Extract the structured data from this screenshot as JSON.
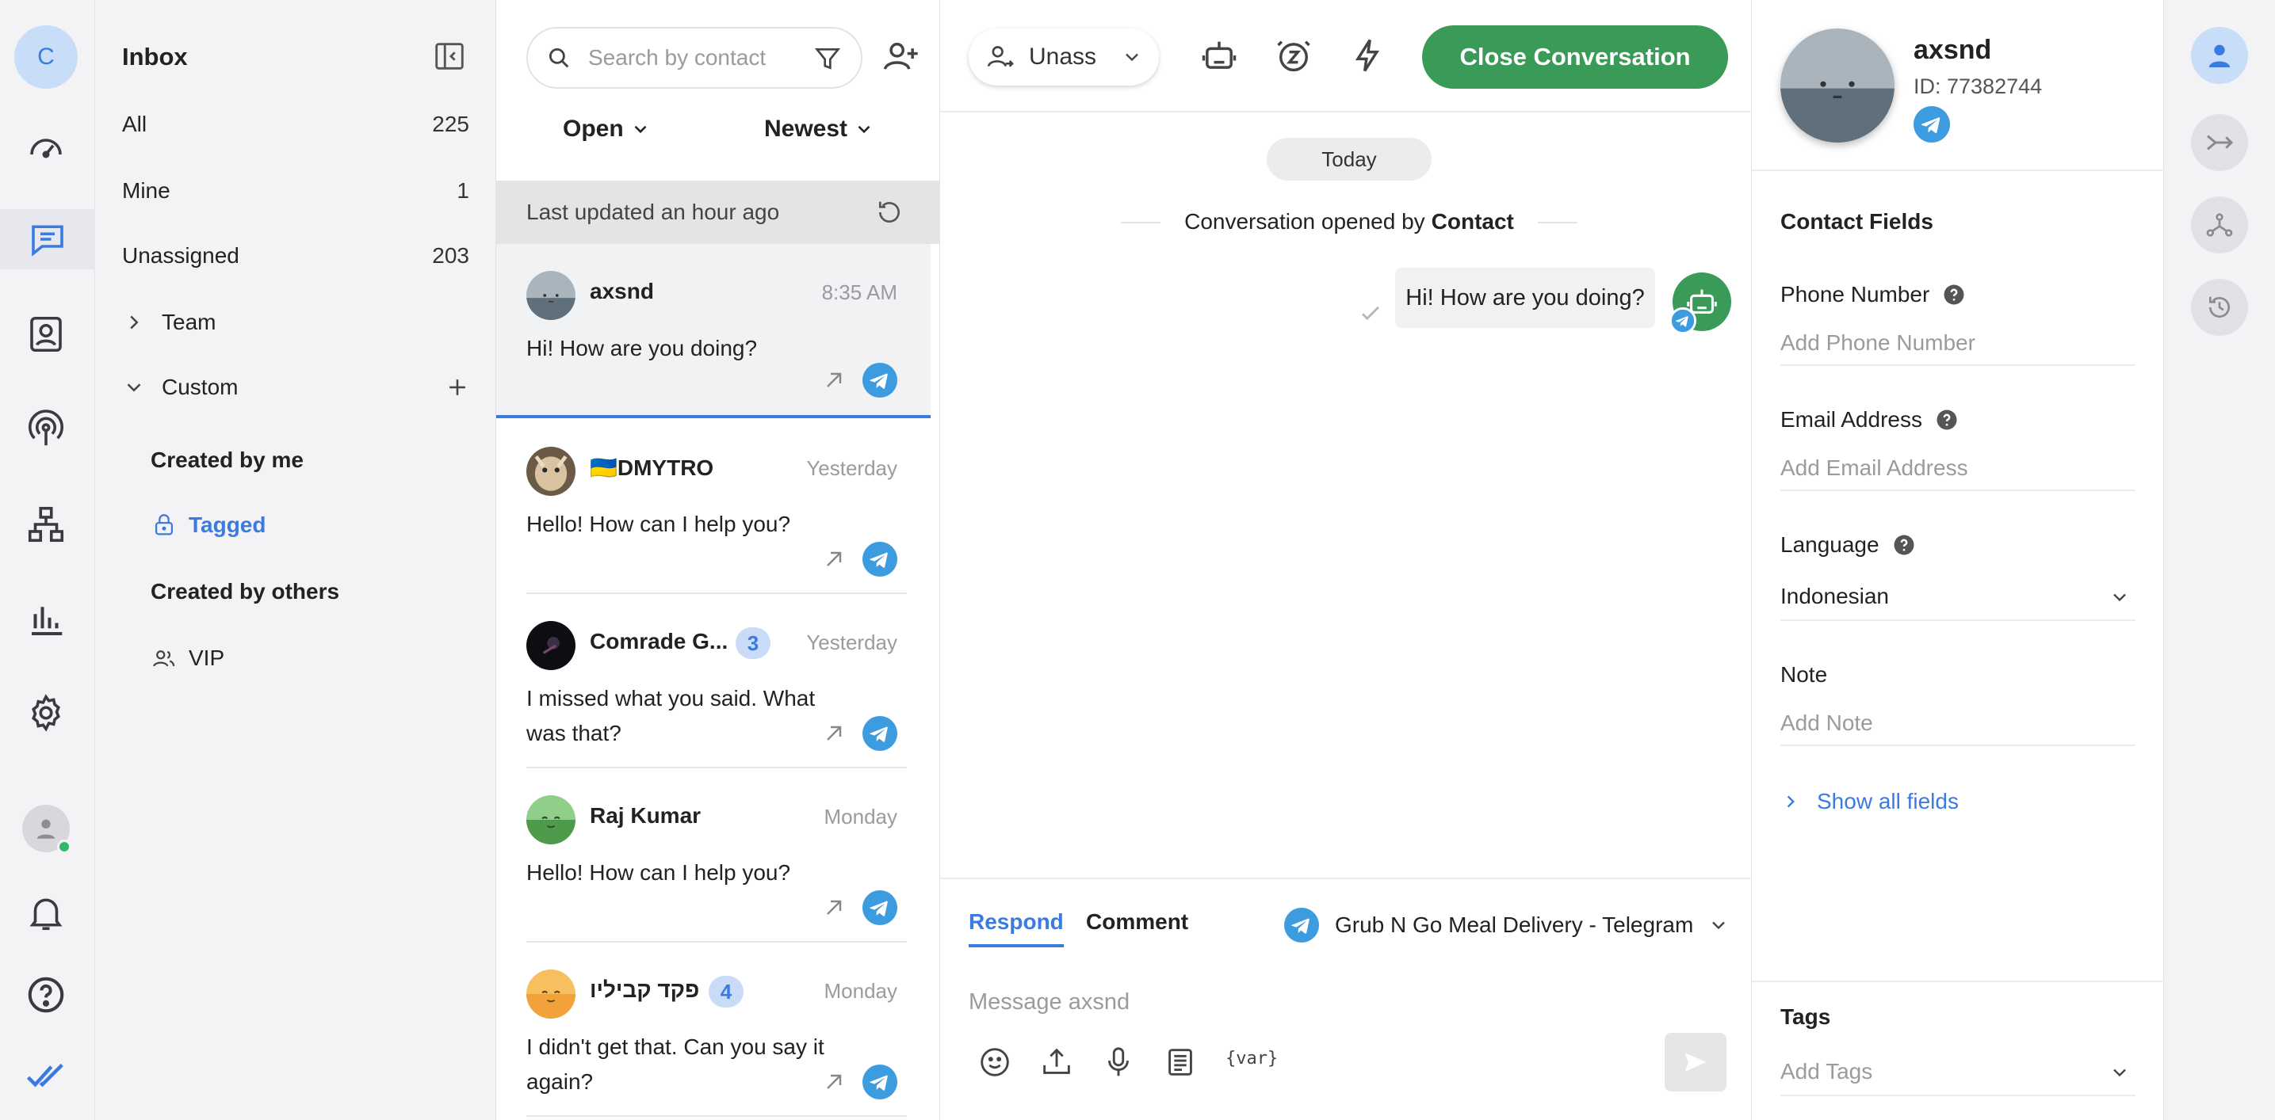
{
  "rail": {
    "avatar_letter": "C"
  },
  "inbox": {
    "title": "Inbox",
    "rows": [
      {
        "label": "All",
        "count": "225"
      },
      {
        "label": "Mine",
        "count": "1"
      },
      {
        "label": "Unassigned",
        "count": "203"
      }
    ],
    "team_label": "Team",
    "custom_label": "Custom",
    "custom_items": [
      {
        "label": "Created by me"
      },
      {
        "label": "Tagged"
      },
      {
        "label": "Created by others"
      },
      {
        "label": "VIP"
      }
    ]
  },
  "convlist": {
    "search_placeholder": "Search by contact",
    "status_filter": "Open",
    "sort": "Newest",
    "last_updated": "Last updated an hour ago",
    "items": [
      {
        "name": "axsnd",
        "time": "8:35 AM",
        "preview": "Hi! How are you doing?",
        "badge": ""
      },
      {
        "name": "🇺🇦DMYTRO",
        "time": "Yesterday",
        "preview": "Hello! How can I help you?",
        "badge": ""
      },
      {
        "name": "Comrade G...",
        "time": "Yesterday",
        "preview": "I missed what you said. What was that?",
        "badge": "3"
      },
      {
        "name": "Raj Kumar",
        "time": "Monday",
        "preview": "Hello! How can I help you?",
        "badge": ""
      },
      {
        "name": "פקד קביליו",
        "time": "Monday",
        "preview": "I didn't get that. Can you say it again?",
        "badge": "4"
      }
    ]
  },
  "chat": {
    "assignee": "Unass",
    "close_label": "Close Conversation",
    "date_divider": "Today",
    "opened_text": "Conversation opened by",
    "opened_by": "Contact",
    "message": "Hi! How are you doing?",
    "composer": {
      "tab_respond": "Respond",
      "tab_comment": "Comment",
      "channel": "Grub N Go Meal Delivery - Telegram",
      "placeholder": "Message axsnd",
      "var_label": "{var}"
    }
  },
  "contact": {
    "name": "axsnd",
    "id_text": "ID: 77382744",
    "fields_title": "Contact Fields",
    "phone_label": "Phone Number",
    "phone_placeholder": "Add Phone Number",
    "email_label": "Email Address",
    "email_placeholder": "Add Email Address",
    "language_label": "Language",
    "language_value": "Indonesian",
    "note_label": "Note",
    "note_placeholder": "Add Note",
    "show_all": "Show all fields",
    "tags_title": "Tags",
    "tags_placeholder": "Add Tags"
  },
  "colors": {
    "accent": "#3b7be0",
    "close_button": "#3a9a58",
    "telegram": "#3d9be0",
    "online": "#33b86a"
  }
}
